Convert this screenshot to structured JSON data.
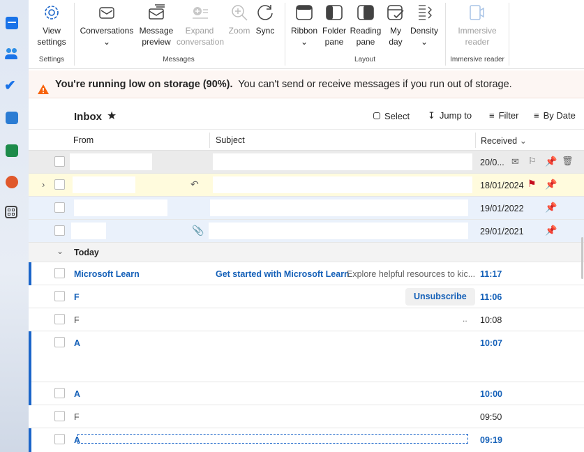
{
  "ribbon": {
    "view_settings": "View settings",
    "conversations": "Conversations",
    "message_preview": "Message preview",
    "expand_conversation": "Expand conversation",
    "zoom": "Zoom",
    "sync": "Sync",
    "ribbon": "Ribbon",
    "folder_pane": "Folder pane",
    "reading_pane": "Reading pane",
    "my_day": "My day",
    "density": "Density",
    "immersive_reader": "Immersive reader",
    "groups": {
      "settings": "Settings",
      "messages": "Messages",
      "layout": "Layout",
      "immersive": "Immersive reader"
    }
  },
  "banner": {
    "bold": "You're running low on storage (90%).",
    "text": "You can't send or receive messages if you run out of storage."
  },
  "list": {
    "title": "Inbox",
    "select": "Select",
    "jump_to": "Jump to",
    "filter": "Filter",
    "sort": "By Date",
    "col_from": "From",
    "col_subject": "Subject",
    "col_received": "Received"
  },
  "pinned": [
    {
      "date": "20/0..."
    },
    {
      "date": "18/01/2024"
    },
    {
      "date": "19/01/2022"
    },
    {
      "date": "29/01/2021"
    }
  ],
  "today_label": "Today",
  "today": [
    {
      "from": "Microsoft Learn",
      "subject": "Get started with Microsoft Learn",
      "preview": "Explore helpful resources to kic...",
      "time": "11:17"
    },
    {
      "from": "F",
      "action": "Unsubscribe",
      "time": "11:06"
    },
    {
      "from": "F",
      "preview": "..",
      "time": "10:08"
    },
    {
      "from": "A",
      "time": "10:07"
    },
    {
      "from": "A",
      "time": "10:00"
    },
    {
      "from": "F",
      "time": "09:50"
    },
    {
      "from": "A",
      "time": "09:19"
    }
  ],
  "colors": {
    "accent": "#1b65c9",
    "flag": "#c50f1f",
    "pinned_bg": "#eaf1fb",
    "selected_bg": "#fffbdd",
    "banner_bg": "#fdf6f3"
  }
}
